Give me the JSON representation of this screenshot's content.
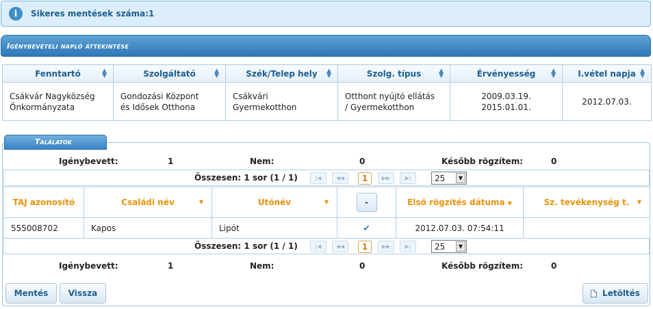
{
  "info_banner": {
    "icon": "info-icon",
    "text": "Sikeres mentések száma:1"
  },
  "section_title": "Igénybevételi napló áttekintése",
  "top_table": {
    "headers": [
      "Fenntartó",
      "Szolgáltató",
      "Szék/Telep hely",
      "Szolg. típus",
      "Érvényesség",
      "I.vétel napja"
    ],
    "row": {
      "fenntarto_1": "Csákvár Nagyközség",
      "fenntarto_2": "Önkormányzata",
      "szolgaltato_1": "Gondozási Központ",
      "szolgaltato_2": "és Idősek Otthona",
      "telep_1": "Csákvári",
      "telep_2": "Gyermekotthon",
      "tipus_1": "Otthont nyújtó ellátás",
      "tipus_2": "/ Gyermekotthon",
      "ervenyesseg_1": "2009.03.19.",
      "ervenyesseg_2": "2015.01.01.",
      "ivetel": "2012.07.03."
    }
  },
  "results": {
    "tab_label": "Találatok",
    "summary": {
      "igenybevett_label": "Igénybevett:",
      "igenybevett_value": "1",
      "nem_label": "Nem:",
      "nem_value": "0",
      "kesobb_label": "Később rögzítem:",
      "kesobb_value": "0"
    },
    "pager": {
      "count_text": "Összesen: 1 sor (1 / 1)",
      "current_page": "1",
      "page_size": "25"
    },
    "columns": [
      "TAJ azonosító",
      "Családi név",
      "Utónév",
      "-",
      "Első rögzítés dátuma",
      "Sz. tevékenység t."
    ],
    "rows": [
      {
        "taj": "555008702",
        "csaladi": "Kapos",
        "utonev": "Lipót",
        "check": "✔",
        "elso": "2012.07.03. 07:54:11",
        "tev": ""
      }
    ]
  },
  "buttons": {
    "mentes": "Mentés",
    "vissza": "Vissza",
    "letoltes": "Letöltés"
  },
  "colors": {
    "accent_blue": "#2f78b8",
    "header_orange": "#e8930c"
  }
}
